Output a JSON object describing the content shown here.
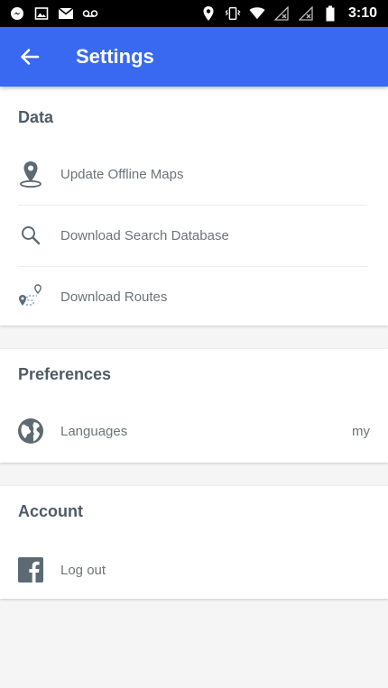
{
  "status_bar": {
    "time": "3:10",
    "left_icons": [
      "messenger-icon",
      "gallery-icon",
      "gmail-icon",
      "voicemail-icon"
    ],
    "right_icons": [
      "location-icon",
      "vibrate-icon",
      "wifi-icon",
      "no-signal-icon",
      "no-signal-icon",
      "battery-icon"
    ]
  },
  "app_bar": {
    "title": "Settings",
    "color": "#3869f0"
  },
  "sections": {
    "data": {
      "header": "Data",
      "items": [
        {
          "label": "Update Offline Maps",
          "icon": "map-pin-icon"
        },
        {
          "label": "Download Search Database",
          "icon": "search-icon"
        },
        {
          "label": "Download Routes",
          "icon": "route-icon"
        }
      ]
    },
    "preferences": {
      "header": "Preferences",
      "items": [
        {
          "label": "Languages",
          "value": "my",
          "icon": "globe-icon"
        }
      ]
    },
    "account": {
      "header": "Account",
      "items": [
        {
          "label": "Log out",
          "icon": "facebook-icon"
        }
      ]
    }
  }
}
